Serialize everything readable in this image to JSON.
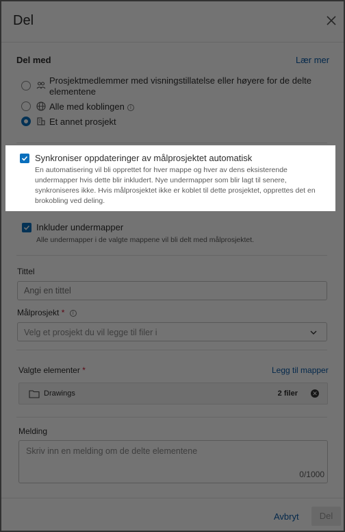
{
  "dialog": {
    "title": "Del"
  },
  "share_with": {
    "label": "Del med",
    "learn_more": "Lær mer",
    "options": [
      {
        "label_line1": "Prosjektmedlemmer med visningstillatelse eller høyere for de delte",
        "label_line2": "elementene",
        "icon": "people-icon",
        "checked": false
      },
      {
        "label": "Alle med koblingen",
        "icon": "globe-icon",
        "checked": false
      },
      {
        "label": "Et annet prosjekt",
        "icon": "building-icon",
        "checked": true
      }
    ]
  },
  "sync": {
    "title": "Synkroniser oppdateringer av målprosjektet automatisk",
    "desc_lines": [
      "En automatisering vil bli opprettet for hver mappe og hver av dens eksisterende",
      "undermapper hvis dette blir inkludert. Nye undermapper som blir lagt til senere,",
      "synkroniseres ikke. Hvis målprosjektet ikke er koblet til dette prosjektet, opprettes det en",
      "brokobling ved deling."
    ],
    "checked": true
  },
  "subfolders": {
    "title": "Inkluder undermapper",
    "desc": "Alle undermapper i de valgte mappene vil bli delt med målprosjektet.",
    "checked": true
  },
  "title_field": {
    "label": "Tittel",
    "placeholder": "Angi en tittel"
  },
  "target_project": {
    "label": "Målprosjekt",
    "required": "*",
    "placeholder": "Velg et prosjekt du vil legge til filer i"
  },
  "selected_items": {
    "label": "Valgte elementer",
    "required": "*",
    "add_link": "Legg til mapper",
    "items": [
      {
        "name": "Drawings",
        "count": "2 filer"
      }
    ]
  },
  "message": {
    "label": "Melding",
    "placeholder": "Skriv inn en melding om de delte elementene",
    "counter": "0/1000"
  },
  "footer": {
    "cancel": "Avbryt",
    "share": "Del"
  },
  "colors": {
    "accent": "#0a6fbd",
    "link": "#0a5aa6",
    "required": "#c8102e"
  }
}
